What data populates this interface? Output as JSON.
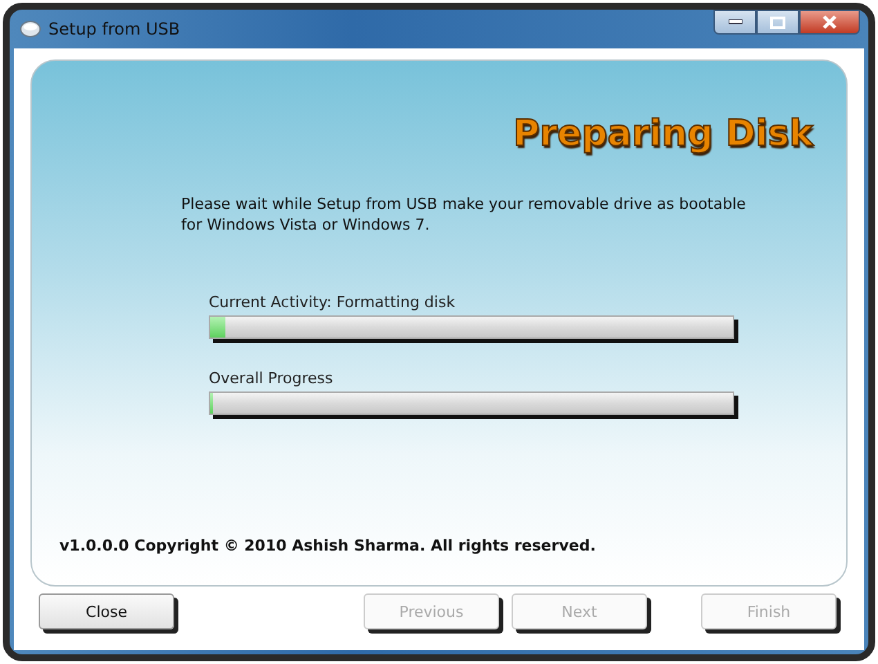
{
  "window": {
    "title": "Setup from USB"
  },
  "heading": "Preparing Disk",
  "message": "Please wait while Setup from USB make your removable drive as bootable for Windows Vista or Windows 7.",
  "progress": [
    {
      "label": "Current Activity: Formatting disk",
      "level": 0.03
    },
    {
      "label": "Overall Progress",
      "level": 0.005
    }
  ],
  "footer": "v1.0.0.0 Copyright © 2010 Ashish Sharma. All rights reserved.",
  "buttons": [
    {
      "label": "Close",
      "disabled": false
    },
    {
      "label": "Previous",
      "disabled": true
    },
    {
      "label": "Next",
      "disabled": true
    },
    {
      "label": "Finish",
      "disabled": true
    }
  ]
}
